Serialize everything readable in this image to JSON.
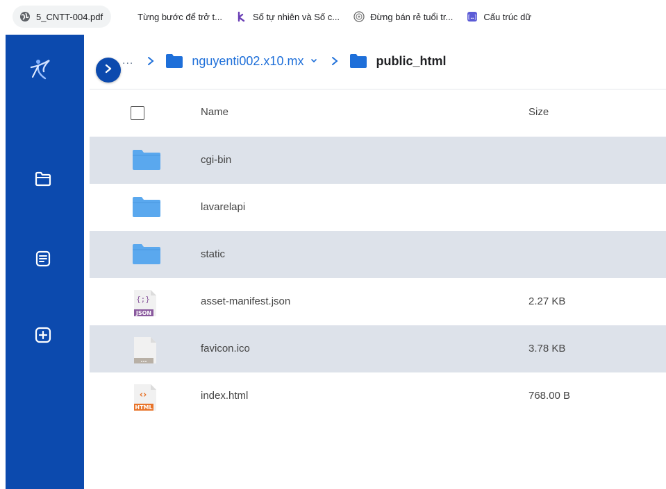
{
  "bookmarks": [
    {
      "label": "5_CNTT-004.pdf",
      "icon": "globe-icon"
    },
    {
      "label": "Từng bước để trở t...",
      "icon": ""
    },
    {
      "label": "Số tự nhiên và Số c...",
      "icon": "k-logo-icon"
    },
    {
      "label": "Đừng bán rẻ tuổi tr...",
      "icon": "badge-icon"
    },
    {
      "label": "Cấu trúc dữ",
      "icon": "code-icon"
    }
  ],
  "breadcrumb": {
    "ellipsis": "...",
    "parent": "nguyenti002.x10.mx",
    "current": "public_html"
  },
  "table": {
    "headers": {
      "name": "Name",
      "size": "Size"
    },
    "rows": [
      {
        "name": "cgi-bin",
        "size": "",
        "type": "folder"
      },
      {
        "name": "lavarelapi",
        "size": "",
        "type": "folder"
      },
      {
        "name": "static",
        "size": "",
        "type": "folder"
      },
      {
        "name": "asset-manifest.json",
        "size": "2.27 KB",
        "type": "json"
      },
      {
        "name": "favicon.ico",
        "size": "3.78 KB",
        "type": "generic"
      },
      {
        "name": "index.html",
        "size": "768.00 B",
        "type": "html"
      }
    ]
  },
  "file_icon_labels": {
    "json": "JSON",
    "html": "HTML",
    "generic": "...",
    "json_glyph": "{;}",
    "html_glyph": "‹›"
  },
  "colors": {
    "sidebar": "#0c4aae",
    "accent": "#1e6fd9",
    "folder": "#5aa8ee",
    "row_shade": "#dde2ea",
    "json_badge": "#8a5a9e",
    "html_badge": "#e8742a"
  }
}
